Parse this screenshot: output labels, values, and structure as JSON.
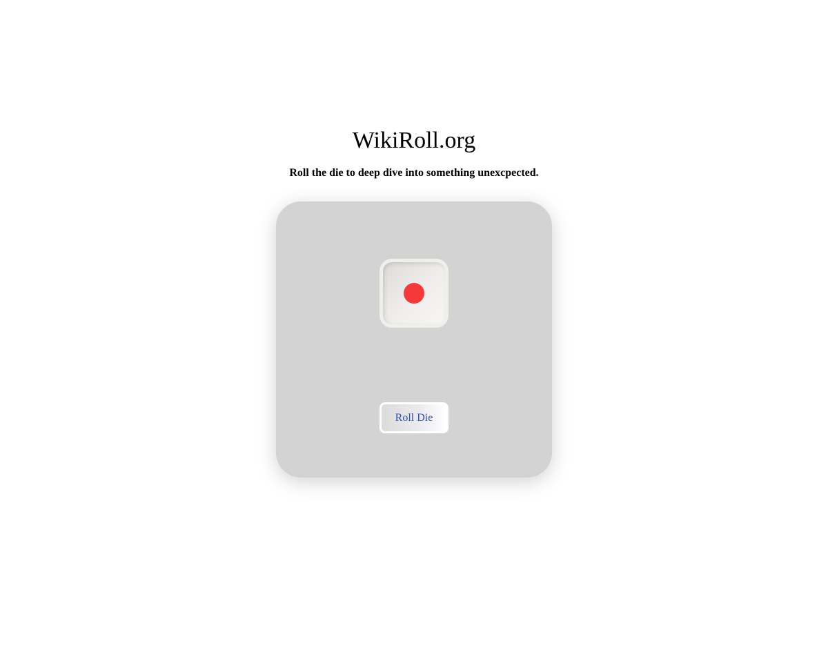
{
  "header": {
    "title": "WikiRoll.org",
    "tagline": "Roll the die to deep dive into something unexcpected."
  },
  "die": {
    "face_value": 1,
    "pip_color": "#f5393a"
  },
  "actions": {
    "roll_label": "Roll Die"
  },
  "colors": {
    "card_background": "#d3d3d3",
    "button_text": "#2d4fb0"
  }
}
